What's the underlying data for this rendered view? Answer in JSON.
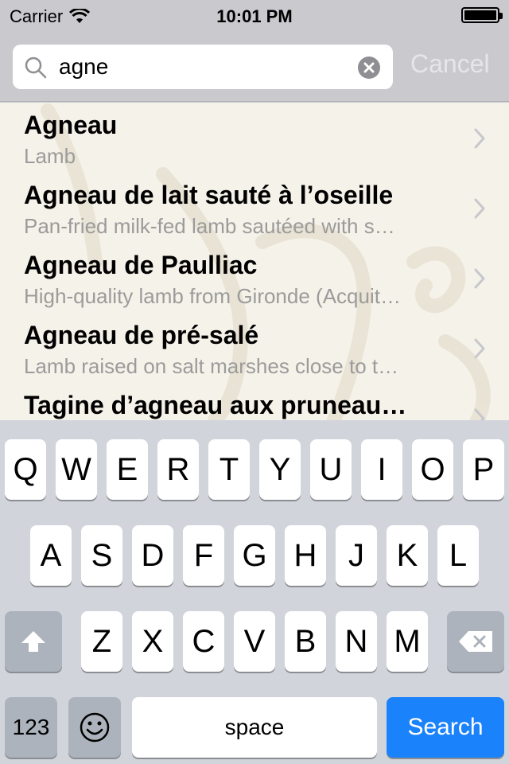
{
  "status_bar": {
    "carrier": "Carrier",
    "time": "10:01 PM",
    "battery_level": 1.0
  },
  "search": {
    "query": "agne",
    "cancel_label": "Cancel"
  },
  "results": [
    {
      "title": "Agneau",
      "subtitle": "Lamb"
    },
    {
      "title": "Agneau de lait sauté à l’oseille",
      "subtitle": "Pan-fried milk-fed lamb sautéed with s…"
    },
    {
      "title": "Agneau de Paulliac",
      "subtitle": "High-quality lamb from Gironde (Acquit…"
    },
    {
      "title": "Agneau de pré-salé",
      "subtitle": "Lamb raised on salt marshes close to t…"
    },
    {
      "title": "Tagine d’agneau aux pruneau…",
      "subtitle": ""
    }
  ],
  "keyboard": {
    "row1": [
      "Q",
      "W",
      "E",
      "R",
      "T",
      "Y",
      "U",
      "I",
      "O",
      "P"
    ],
    "row2": [
      "A",
      "S",
      "D",
      "F",
      "G",
      "H",
      "J",
      "K",
      "L"
    ],
    "row3": [
      "Z",
      "X",
      "C",
      "V",
      "B",
      "N",
      "M"
    ],
    "numbers_label": "123",
    "space_label": "space",
    "search_label": "Search",
    "icons": {
      "shift": "shift-icon",
      "delete": "delete-icon",
      "emoji": "emoji-icon"
    }
  },
  "colors": {
    "search_key": "#1a82fb",
    "list_background": "#f5f2e9",
    "keyboard_background": "#d1d5db"
  }
}
